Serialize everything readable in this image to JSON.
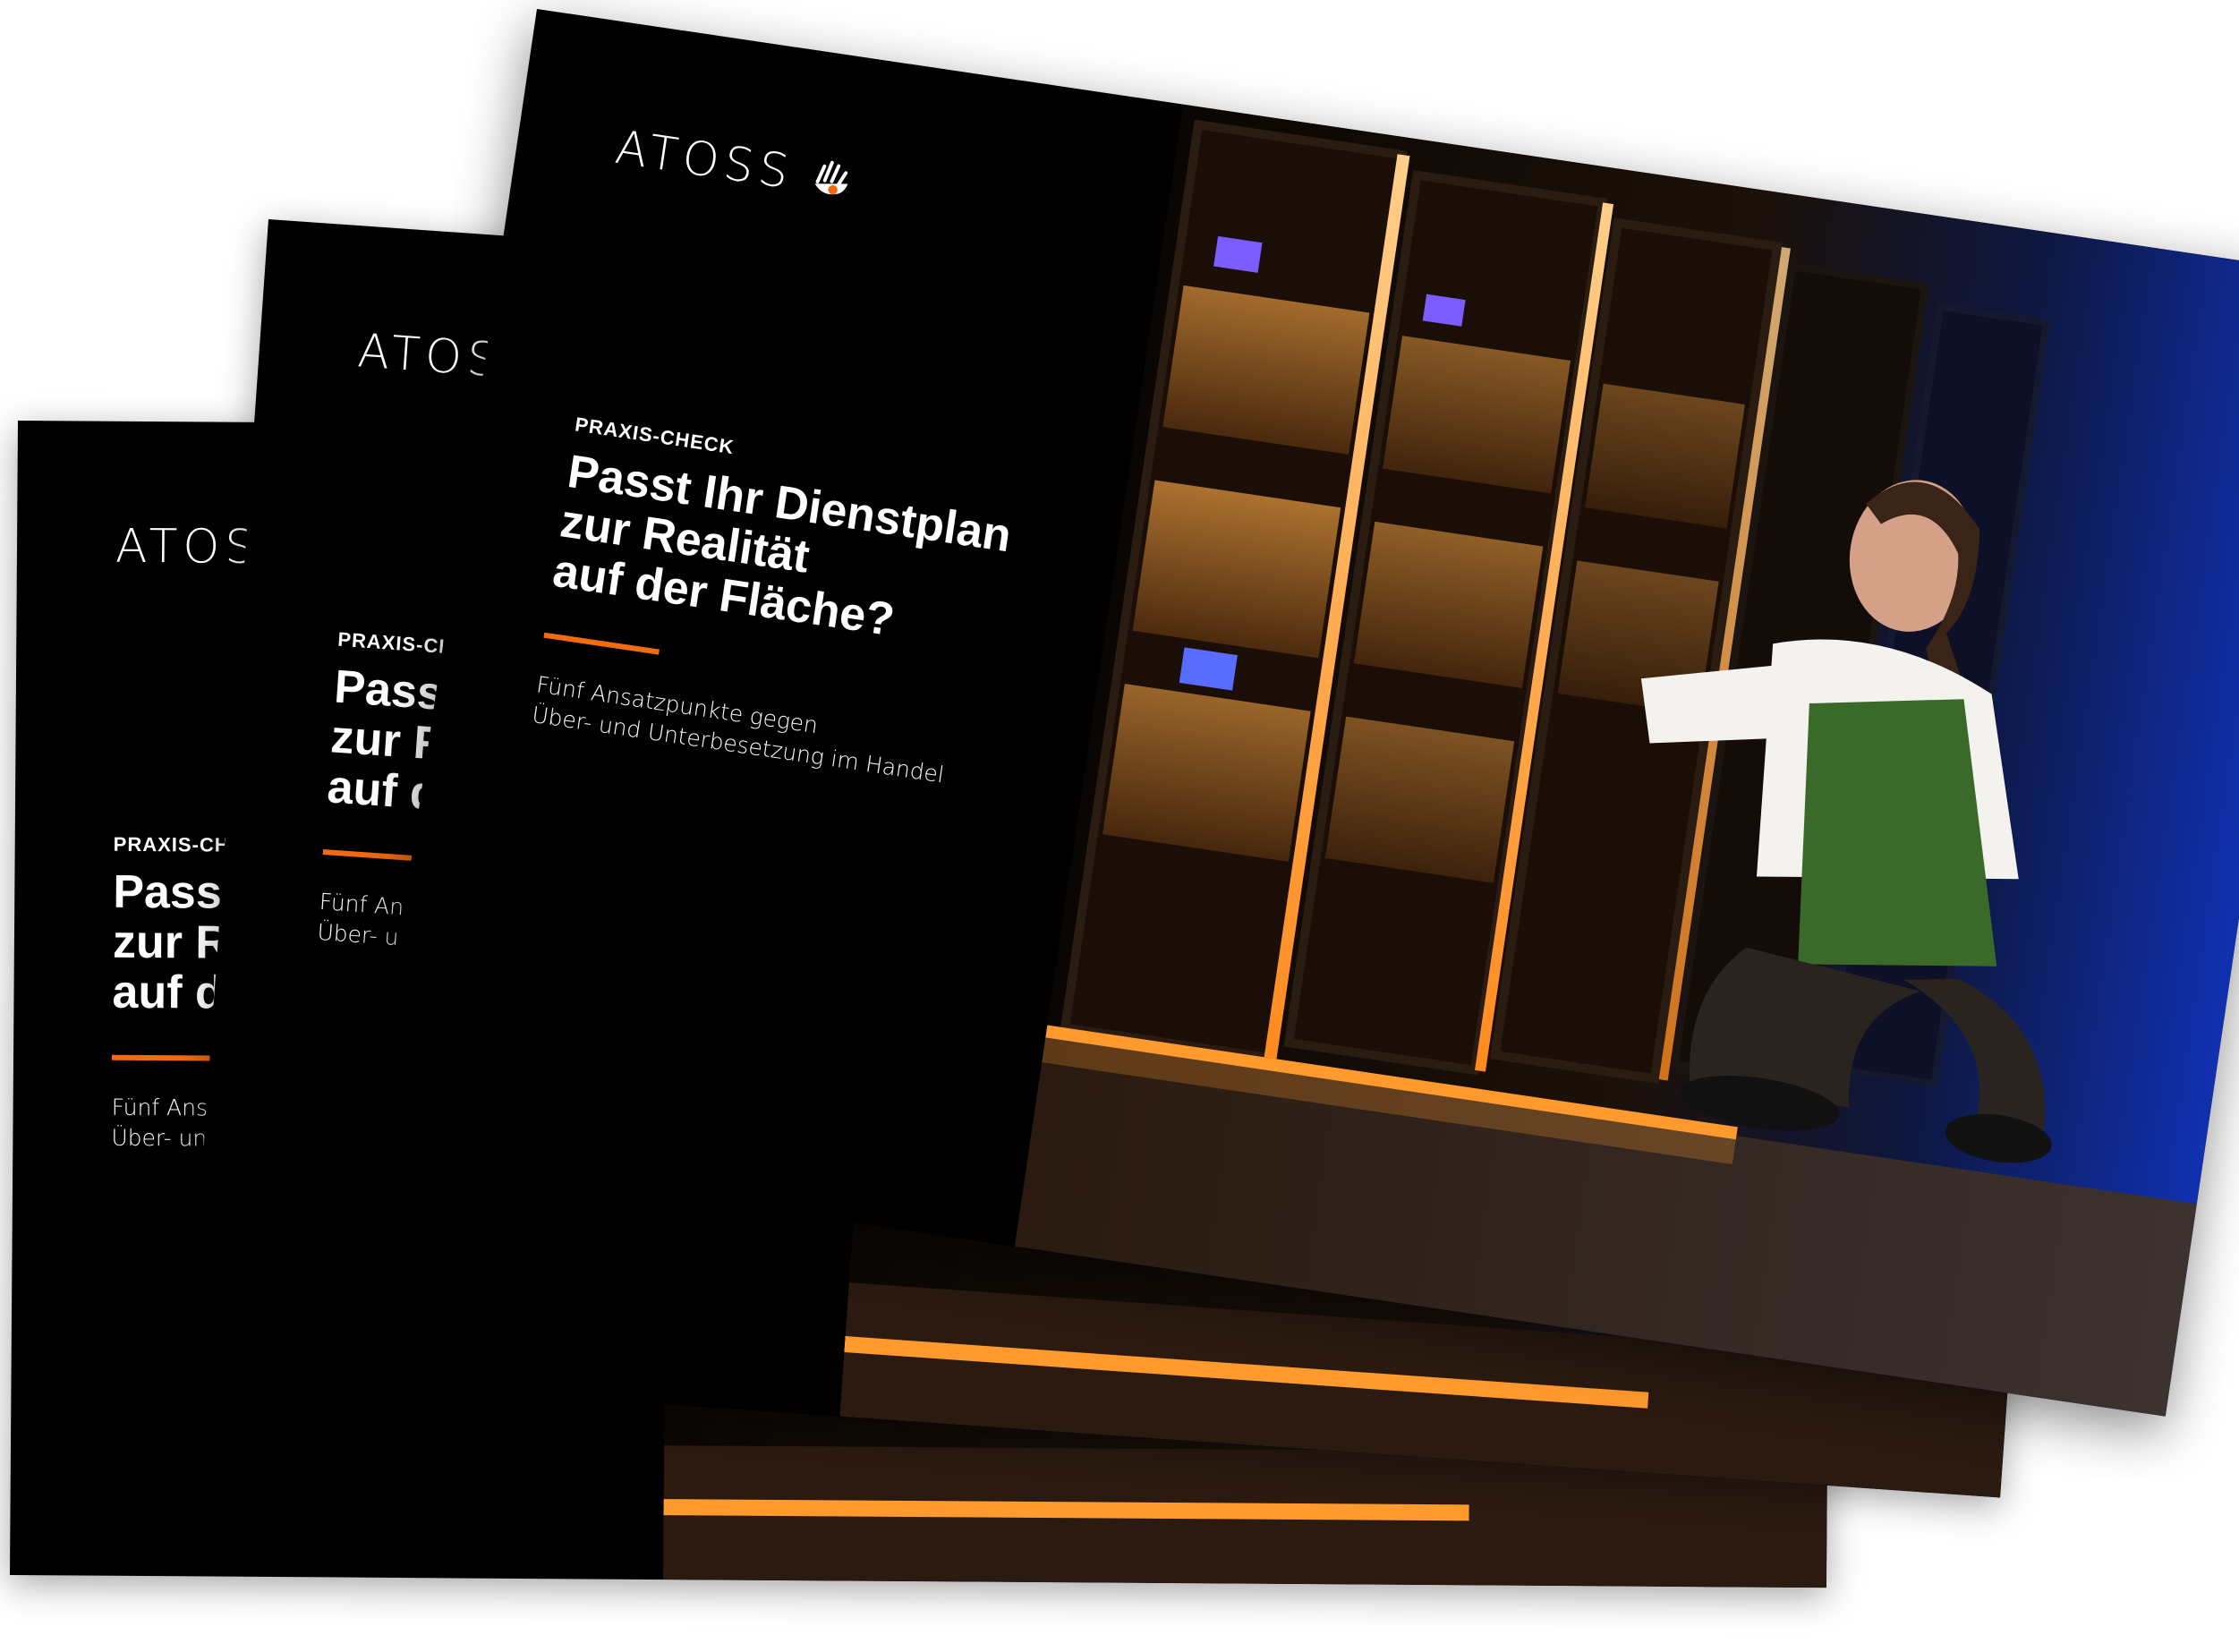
{
  "brochure": {
    "logo_text": "ATOSS",
    "kicker": "PRAXIS-CHECK",
    "title_line1": "Passt Ihr Dienstplan",
    "title_line2": "zur Realität",
    "title_line3": "auf der Fläche?",
    "subtitle_line1": "Fünf Ansatzpunkte gegen",
    "subtitle_line2": "Über- und Unterbesetzung im Handel",
    "accent_color": "#f26b0f",
    "background_color": "#000000",
    "logo_icon": "hand-icon",
    "photo_icon": "retail-fridge-photo"
  }
}
